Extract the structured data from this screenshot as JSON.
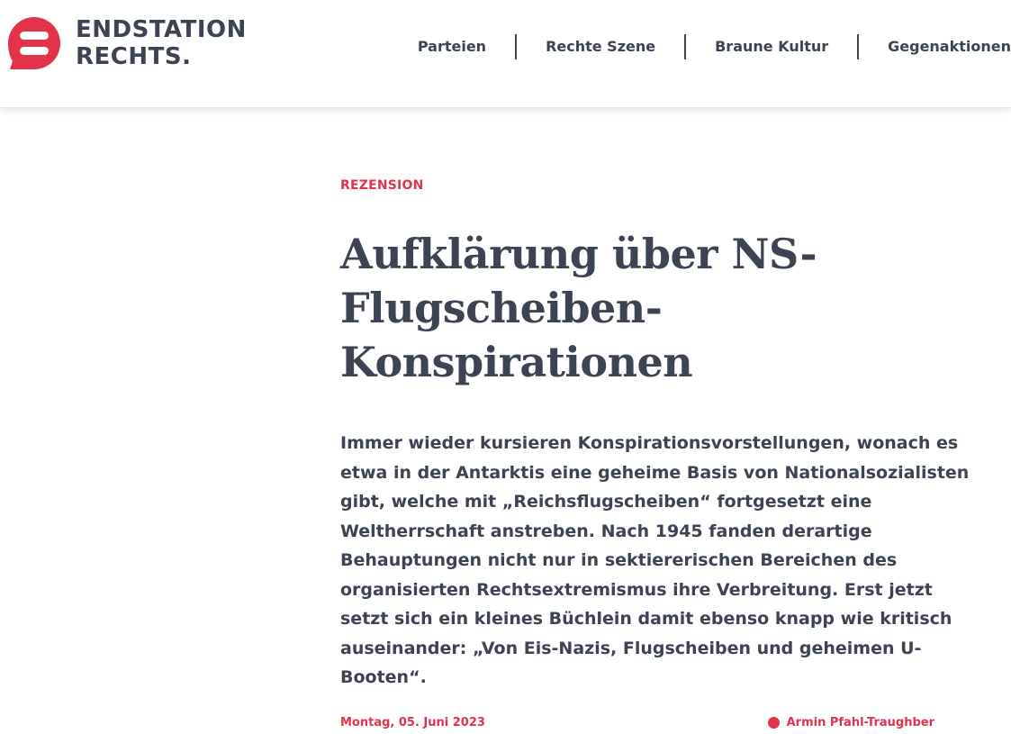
{
  "brand": {
    "name_line1": "ENDSTATION",
    "name_line2": "RECHTS",
    "name_dot": ".",
    "accent_color": "#e2334a",
    "text_color": "#3c4453"
  },
  "nav": {
    "items": [
      {
        "label": "Parteien"
      },
      {
        "label": "Rechte Szene"
      },
      {
        "label": "Braune Kultur"
      },
      {
        "label": "Gegenaktionen"
      }
    ]
  },
  "article": {
    "kicker": "REZENSION",
    "title": "Aufklärung über NS-Flugscheiben-Konspirationen",
    "lead": "Immer wieder kursieren Konspirationsvorstellungen, wonach es etwa in der Antarktis eine geheime Basis von Nationalsozialisten gibt, welche mit „Reichsflugscheiben“ fortgesetzt eine Weltherrschaft anstreben. Nach 1945 fanden derartige Behauptungen nicht nur in sektiererischen Bereichen des organisierten Rechtsextremismus ihre Verbreitung. Erst jetzt setzt sich ein kleines Büchlein damit ebenso knapp wie kritisch auseinander: „Von Eis-Nazis, Flugscheiben und geheimen U-Booten“.",
    "date": "Montag, 05. Juni 2023",
    "author": "Armin Pfahl-Traughber"
  }
}
